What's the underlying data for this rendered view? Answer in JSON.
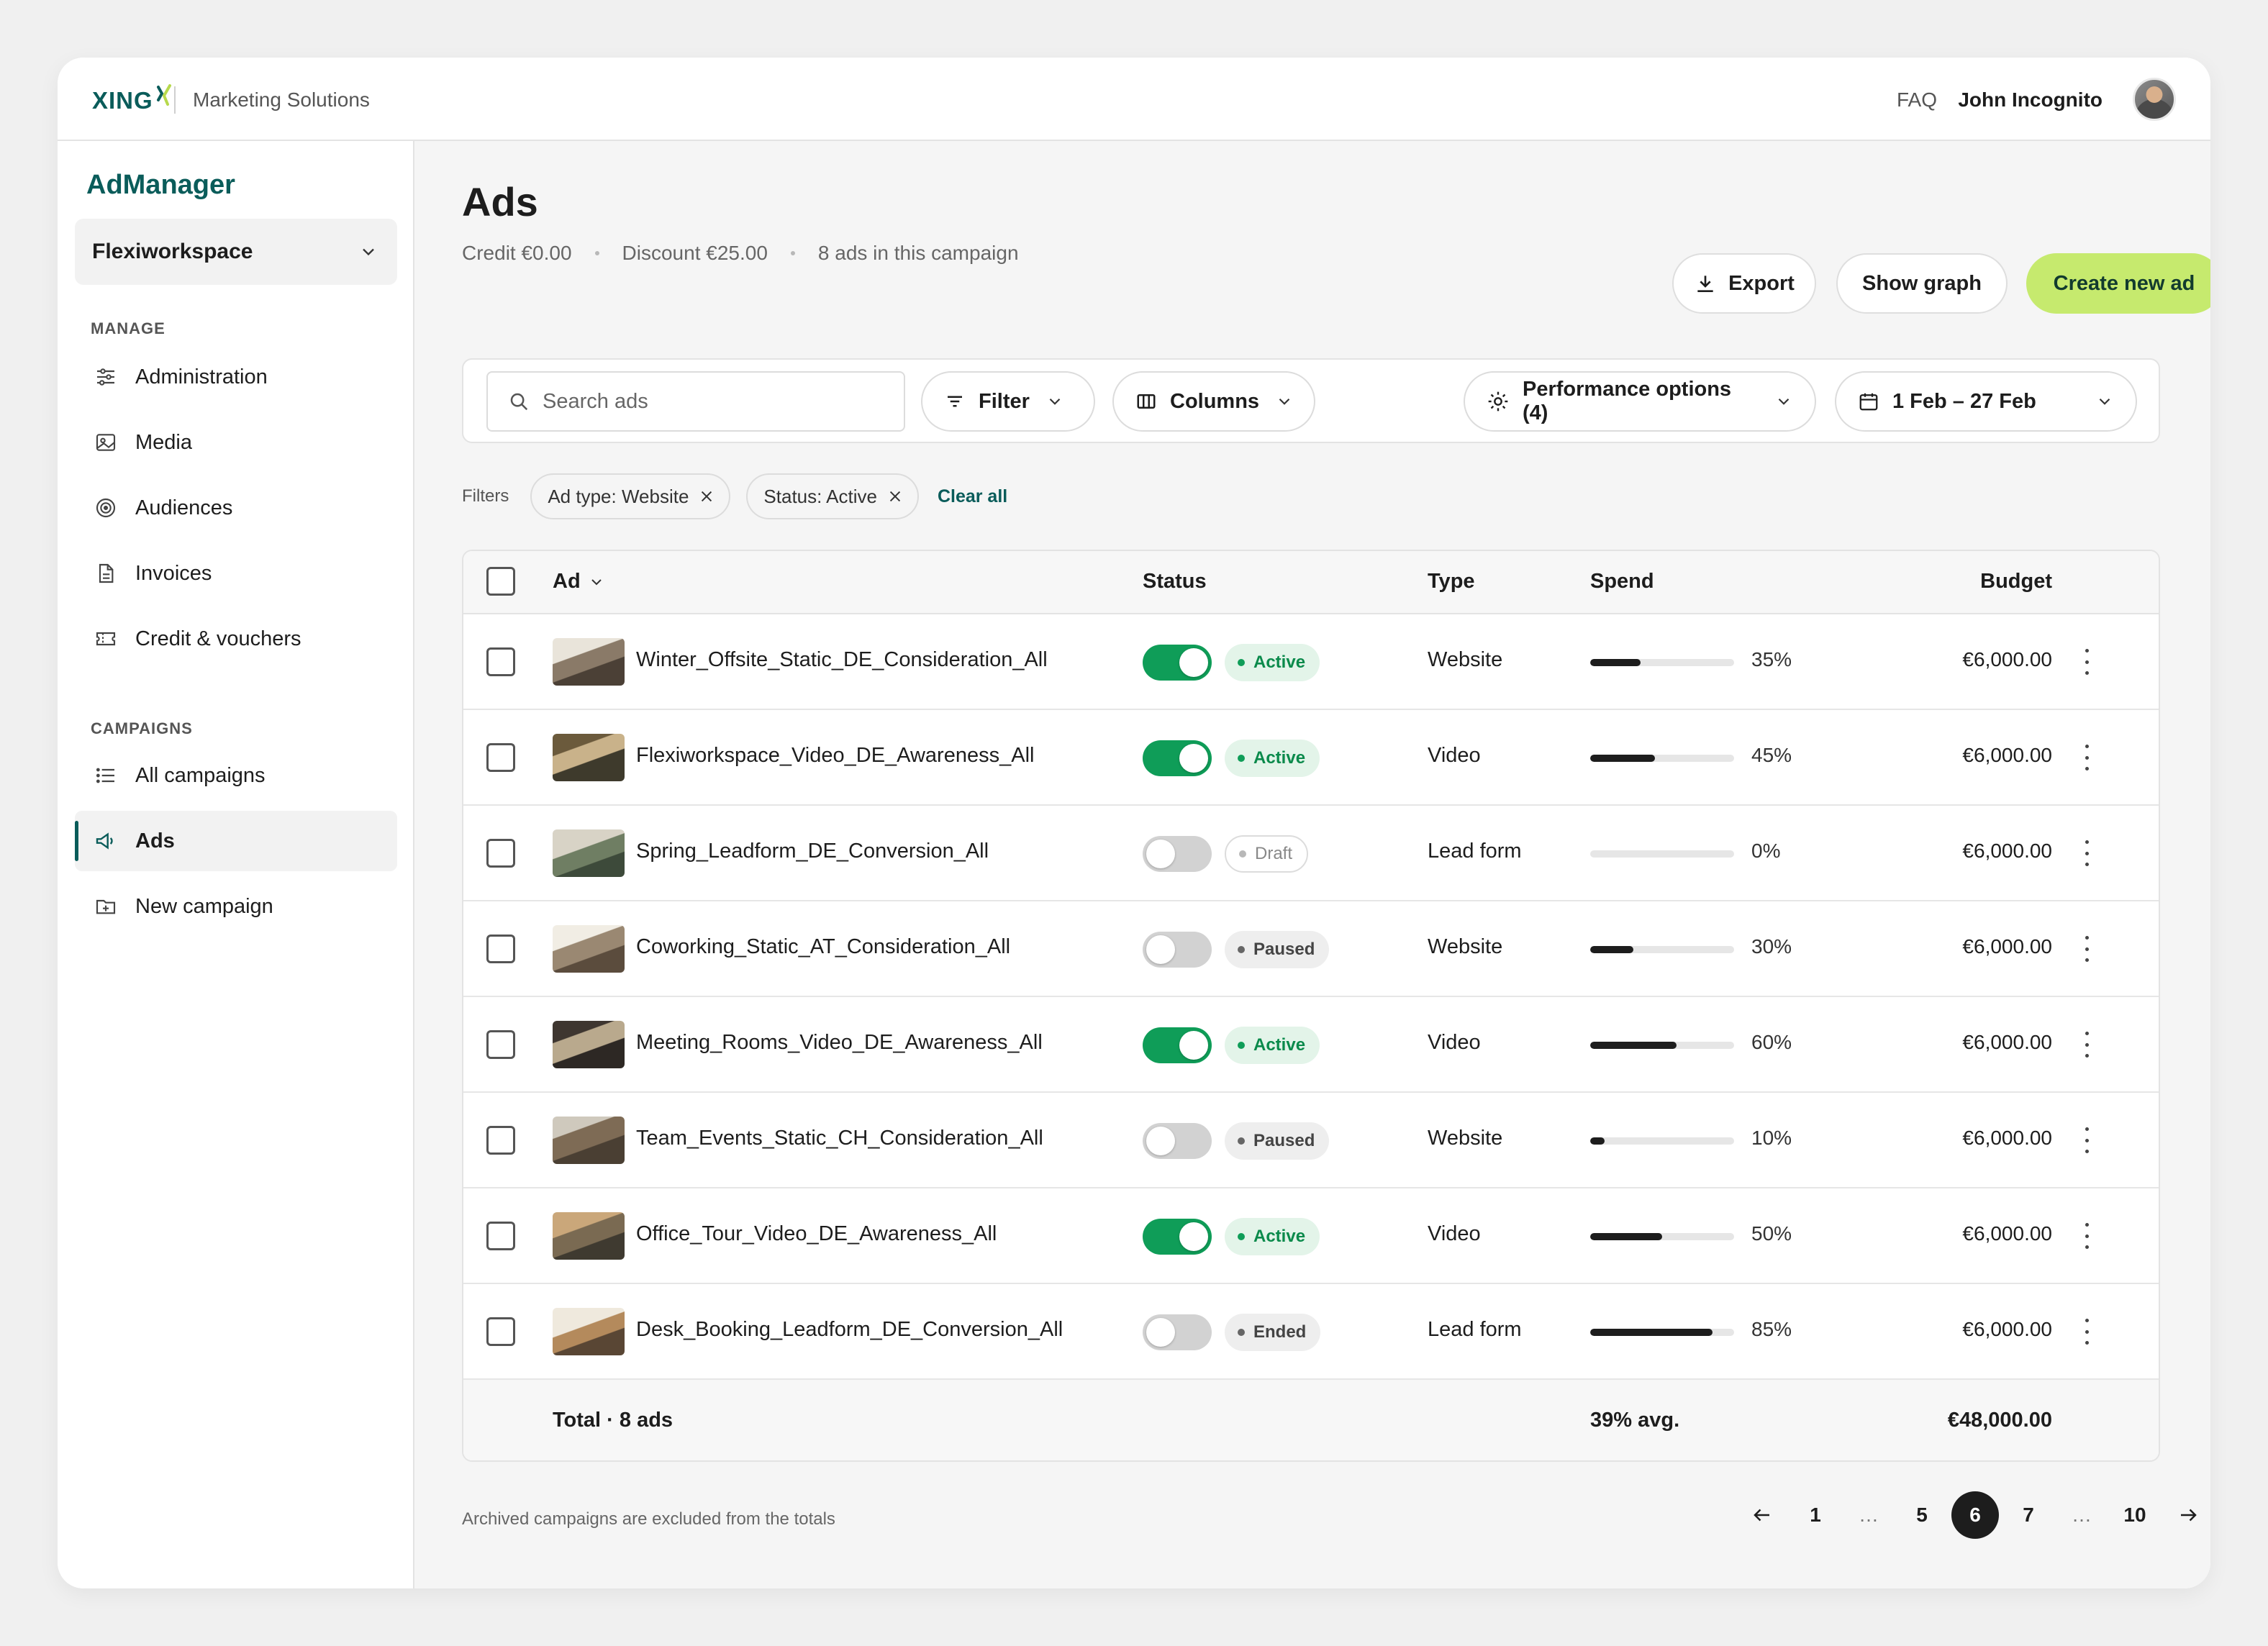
{
  "topbar": {
    "logo_text": "XING",
    "product": "Marketing Solutions",
    "faq": "FAQ",
    "user_name": "John Incognito"
  },
  "sidebar": {
    "brand": "AdManager",
    "workspace": "Flexiworkspace",
    "manage_label": "MANAGE",
    "manage_items": [
      {
        "label": "Administration",
        "icon": "sliders-icon"
      },
      {
        "label": "Media",
        "icon": "image-icon"
      },
      {
        "label": "Audiences",
        "icon": "target-icon"
      },
      {
        "label": "Invoices",
        "icon": "document-icon"
      },
      {
        "label": "Credit & vouchers",
        "icon": "ticket-icon"
      }
    ],
    "campaigns_label": "CAMPAIGNS",
    "campaign_items": [
      {
        "label": "All campaigns",
        "icon": "list-icon"
      },
      {
        "label": "Ads",
        "icon": "megaphone-icon",
        "active": true
      },
      {
        "label": "New campaign",
        "icon": "folder-plus-icon"
      }
    ]
  },
  "header": {
    "title": "Ads",
    "credit": "Credit €0.00",
    "discount": "Discount €25.00",
    "ads_count": "8 ads in this campaign",
    "export_label": "Export",
    "graph_label": "Show graph",
    "create_label": "Create new ad"
  },
  "toolbar": {
    "search_placeholder": "Search ads",
    "filter_label": "Filter",
    "columns_label": "Columns",
    "performance_label": "Performance options (4)",
    "date_range": "1 Feb – 27 Feb"
  },
  "filters": {
    "label": "Filters",
    "chips": [
      "Ad type: Website",
      "Status: Active"
    ],
    "clear_all": "Clear all"
  },
  "table": {
    "columns": {
      "ad": "Ad",
      "status": "Status",
      "type": "Type",
      "spend": "Spend",
      "budget": "Budget"
    },
    "rows": [
      {
        "name": "Winter_Offsite_Static_DE_Consideration_All",
        "on": true,
        "status": "Active",
        "type": "Website",
        "spend": 35,
        "spend_label": "35%",
        "budget": "€6,000.00"
      },
      {
        "name": "Flexiworkspace_Video_DE_Awareness_All",
        "on": true,
        "status": "Active",
        "type": "Video",
        "spend": 45,
        "spend_label": "45%",
        "budget": "€6,000.00"
      },
      {
        "name": "Spring_Leadform_DE_Conversion_All",
        "on": false,
        "status": "Draft",
        "type": "Lead form",
        "spend": 0,
        "spend_label": "0%",
        "budget": "€6,000.00"
      },
      {
        "name": "Coworking_Static_AT_Consideration_All",
        "on": false,
        "status": "Paused",
        "type": "Website",
        "spend": 30,
        "spend_label": "30%",
        "budget": "€6,000.00"
      },
      {
        "name": "Meeting_Rooms_Video_DE_Awareness_All",
        "on": true,
        "status": "Active",
        "type": "Video",
        "spend": 60,
        "spend_label": "60%",
        "budget": "€6,000.00"
      },
      {
        "name": "Team_Events_Static_CH_Consideration_All",
        "on": false,
        "status": "Paused",
        "type": "Website",
        "spend": 10,
        "spend_label": "10%",
        "budget": "€6,000.00"
      },
      {
        "name": "Office_Tour_Video_DE_Awareness_All",
        "on": true,
        "status": "Active",
        "type": "Video",
        "spend": 50,
        "spend_label": "50%",
        "budget": "€6,000.00"
      },
      {
        "name": "Desk_Booking_Leadform_DE_Conversion_All",
        "on": false,
        "status": "Ended",
        "type": "Lead form",
        "spend": 85,
        "spend_label": "85%",
        "budget": "€6,000.00"
      }
    ],
    "total_label": "Total · 8 ads",
    "total_spend": "39% avg.",
    "total_budget": "€48,000.00"
  },
  "footer": {
    "note": "Archived campaigns are excluded from the totals",
    "pages": [
      "1",
      "…",
      "5",
      "6",
      "7",
      "…",
      "10"
    ],
    "current_page": "6"
  },
  "colors": {
    "brand": "#0a5c5a",
    "accent": "#c6ea6e",
    "active": "#0f9d58"
  }
}
